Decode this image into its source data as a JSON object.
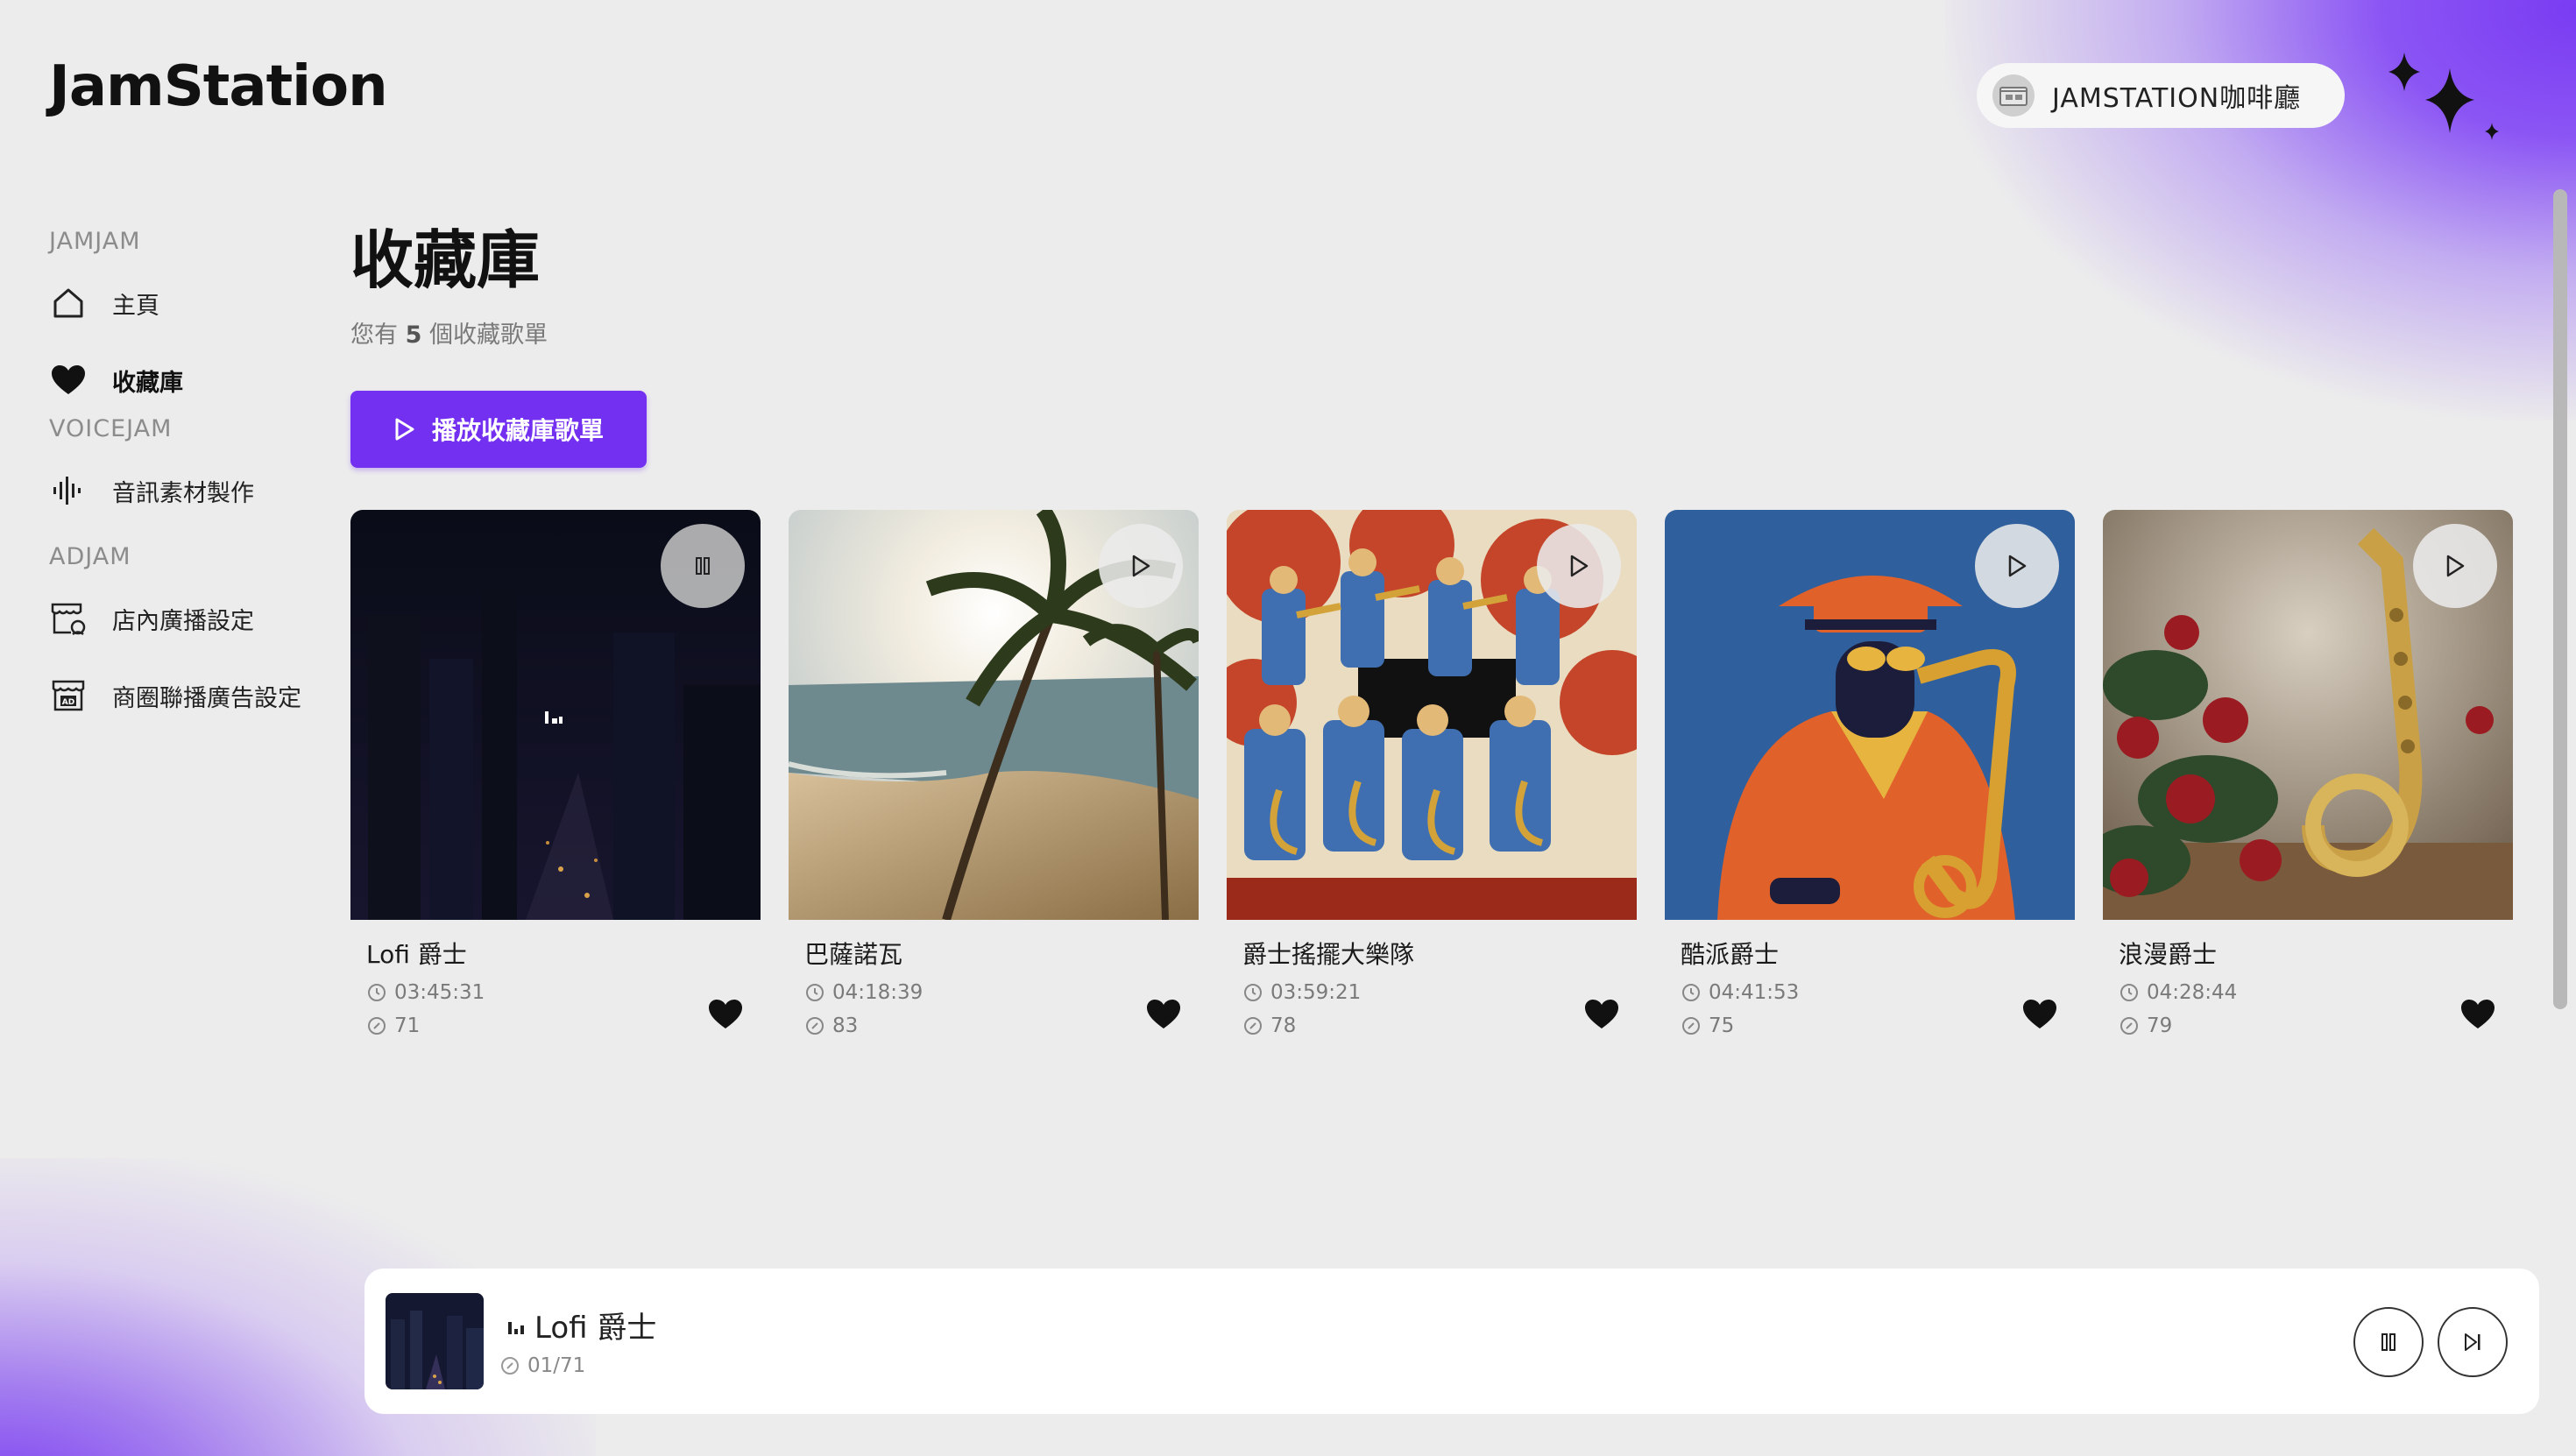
{
  "app": {
    "logo": "JamStation"
  },
  "user": {
    "name": "JAMSTATION咖啡廳",
    "avatar_icon": "store-avatar-icon"
  },
  "sidebar": {
    "sections": [
      {
        "label": "JAMJAM"
      },
      {
        "label": "VOICEJAM"
      },
      {
        "label": "ADJAM"
      }
    ],
    "items": [
      {
        "label": "主頁",
        "icon": "home-icon"
      },
      {
        "label": "收藏庫",
        "icon": "heart-icon",
        "active": true
      },
      {
        "label": "音訊素材製作",
        "icon": "waveform-icon"
      },
      {
        "label": "店內廣播設定",
        "icon": "store-broadcast-icon"
      },
      {
        "label": "商圈聯播廣告設定",
        "icon": "ad-store-icon"
      }
    ]
  },
  "main": {
    "title": "收藏庫",
    "subtitle_prefix": "您有",
    "subtitle_count": "5",
    "subtitle_suffix": "個收藏歌單",
    "play_all_label": "播放收藏庫歌單"
  },
  "playlists": [
    {
      "title": "Lofi 爵士",
      "duration": "03:45:31",
      "tracks": "71",
      "playing": true,
      "favorite": true
    },
    {
      "title": "巴薩諾瓦",
      "duration": "04:18:39",
      "tracks": "83",
      "playing": false,
      "favorite": true
    },
    {
      "title": "爵士搖擺大樂隊",
      "duration": "03:59:21",
      "tracks": "78",
      "playing": false,
      "favorite": true
    },
    {
      "title": "酷派爵士",
      "duration": "04:41:53",
      "tracks": "75",
      "playing": false,
      "favorite": true
    },
    {
      "title": "浪漫爵士",
      "duration": "04:28:44",
      "tracks": "79",
      "playing": false,
      "favorite": true
    }
  ],
  "player": {
    "title": "Lofi 爵士",
    "track_position": "01/71",
    "state": "playing"
  },
  "colors": {
    "accent": "#7330f0",
    "background": "#ececec"
  }
}
